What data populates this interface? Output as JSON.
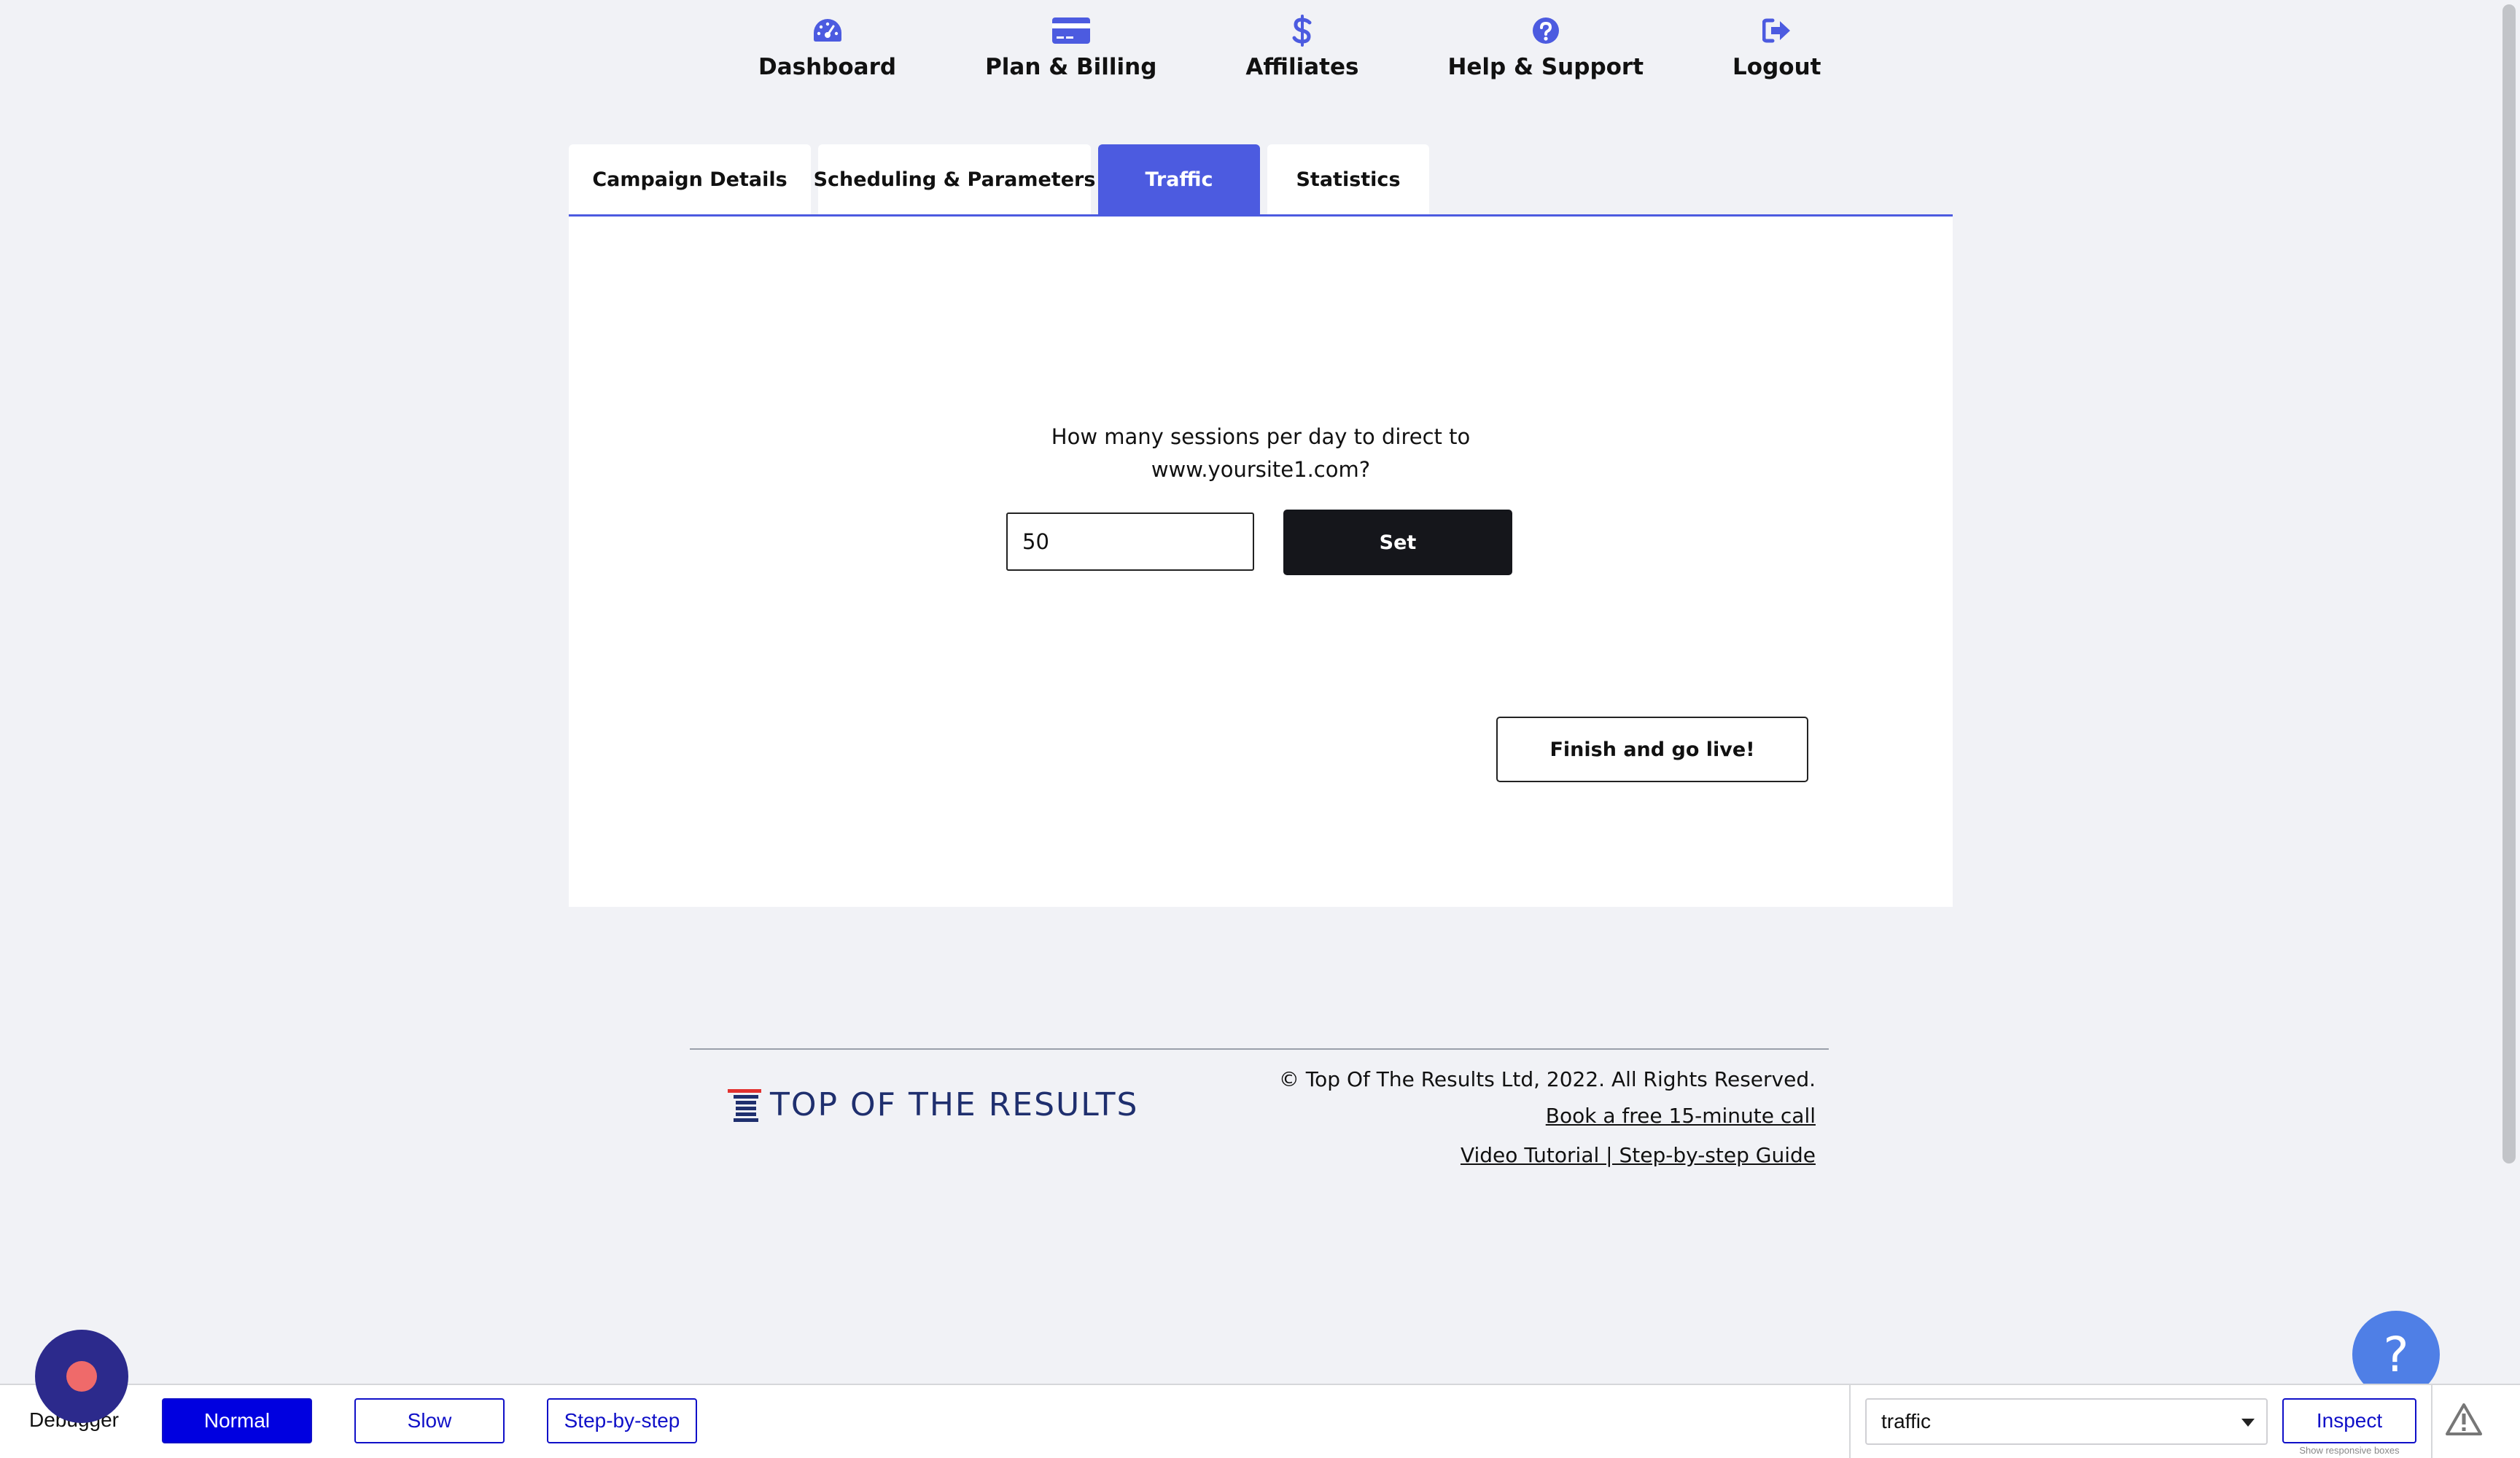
{
  "nav": {
    "items": [
      {
        "label": "Dashboard",
        "icon": "speedometer-icon"
      },
      {
        "label": "Plan & Billing",
        "icon": "credit-card-icon"
      },
      {
        "label": "Affiliates",
        "icon": "dollar-icon"
      },
      {
        "label": "Help & Support",
        "icon": "question-circle-icon"
      },
      {
        "label": "Logout",
        "icon": "sign-out-icon"
      }
    ],
    "icon_color": "#4c5be0"
  },
  "tabs": [
    {
      "label": "Campaign Details",
      "active": false
    },
    {
      "label": "Scheduling & Parameters",
      "active": false
    },
    {
      "label": "Traffic",
      "active": true
    },
    {
      "label": "Statistics",
      "active": false
    }
  ],
  "traffic": {
    "question_line1": "How many sessions per day to direct to",
    "question_line2": "www.yoursite1.com?",
    "sessions_value": "50",
    "set_label": "Set",
    "finish_label": "Finish and go live!"
  },
  "footer": {
    "logo_text": "TOP OF THE RESULTS",
    "copyright": "© Top Of The Results Ltd, 2022. All Rights Reserved.",
    "book_call": "Book a free 15-minute call",
    "tutorial": "Video Tutorial | Step-by-step Guide"
  },
  "help": {
    "symbol": "?"
  },
  "debugger": {
    "label": "Debugger",
    "modes": {
      "normal": "Normal",
      "slow": "Slow",
      "step": "Step-by-step"
    },
    "active_mode": "Normal",
    "target_value": "traffic",
    "inspect_label": "Inspect",
    "responsive_note": "Show responsive boxes"
  },
  "colors": {
    "accent": "#4c5be0",
    "dark_button": "#15161b",
    "help_bubble": "#4f7fe6",
    "debug_blue": "#1010c8",
    "record_bg": "#2c2a8c",
    "record_dot": "#ef6a6a"
  }
}
